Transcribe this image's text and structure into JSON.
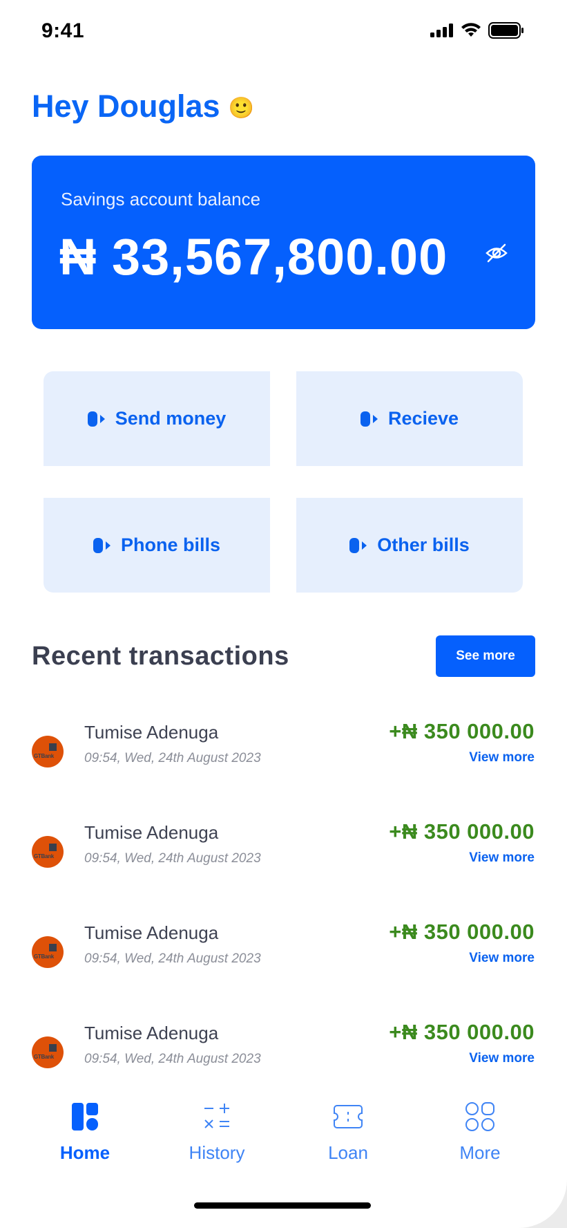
{
  "status_bar": {
    "time": "9:41"
  },
  "greeting": {
    "text": "Hey Douglas",
    "emoji": "🙂"
  },
  "balance": {
    "label": "Savings account balance",
    "amount": "₦ 33,567,800.00"
  },
  "actions": [
    {
      "label": "Send money"
    },
    {
      "label": "Recieve"
    },
    {
      "label": "Phone bills"
    },
    {
      "label": "Other bills"
    }
  ],
  "recent": {
    "title": "Recent transactions",
    "see_more": "See more",
    "transactions": [
      {
        "bank": "GTBank",
        "name": "Tumise Adenuga",
        "date": "09:54, Wed, 24th August 2023",
        "amount": "+₦ 350 000.00",
        "view": "View more"
      },
      {
        "bank": "GTBank",
        "name": "Tumise Adenuga",
        "date": "09:54, Wed, 24th August 2023",
        "amount": "+₦ 350 000.00",
        "view": "View more"
      },
      {
        "bank": "GTBank",
        "name": "Tumise Adenuga",
        "date": "09:54, Wed, 24th August 2023",
        "amount": "+₦ 350 000.00",
        "view": "View more"
      },
      {
        "bank": "GTBank",
        "name": "Tumise Adenuga",
        "date": "09:54, Wed, 24th August 2023",
        "amount": "+₦ 350 000.00",
        "view": "View more"
      }
    ]
  },
  "nav": [
    {
      "label": "Home",
      "icon": "home-icon",
      "active": true
    },
    {
      "label": "History",
      "icon": "calculator-icon",
      "active": false
    },
    {
      "label": "Loan",
      "icon": "ticket-icon",
      "active": false
    },
    {
      "label": "More",
      "icon": "grid-icon",
      "active": false
    }
  ],
  "colors": {
    "primary": "#0560fd",
    "tile_bg": "#e6effd",
    "amount_green": "#3b8a1e",
    "avatar_orange": "#de5108"
  }
}
